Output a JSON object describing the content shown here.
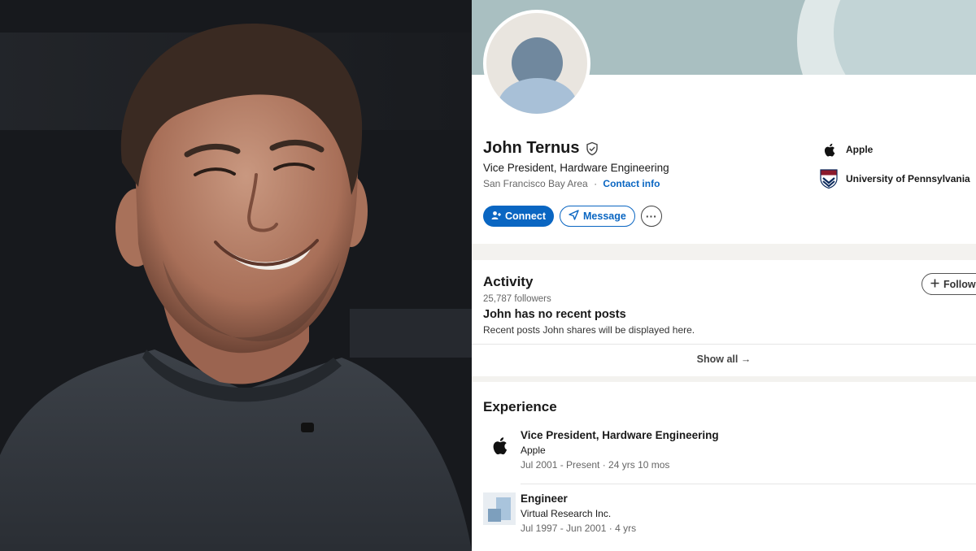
{
  "profile": {
    "name": "John Ternus",
    "headline": "Vice President, Hardware Engineering",
    "location": "San Francisco Bay Area",
    "separator": "·",
    "contact_info": "Contact info",
    "verified_icon": "shield-check-icon"
  },
  "actions": {
    "connect": "Connect",
    "message": "Message",
    "more": "···"
  },
  "orgs": [
    {
      "name": "Apple",
      "icon": "apple-logo-icon"
    },
    {
      "name": "University of Pennsylvania",
      "icon": "penn-shield-icon"
    }
  ],
  "activity": {
    "title": "Activity",
    "followers": "25,787 followers",
    "follow_label": "Follow",
    "empty_title": "John has no recent posts",
    "empty_subtitle": "Recent posts John shares will be displayed here.",
    "show_all": "Show all →"
  },
  "experience": {
    "title": "Experience",
    "items": [
      {
        "title": "Vice President, Hardware Engineering",
        "company": "Apple",
        "dates": "Jul 2001 - Present · 24 yrs 10 mos",
        "logo": "apple-logo-icon"
      },
      {
        "title": "Engineer",
        "company": "Virtual Research Inc.",
        "dates": "Jul 1997 - Jun 2001 · 4 yrs",
        "logo": "company-placeholder-icon"
      }
    ]
  },
  "colors": {
    "brand_blue": "#0a66c2",
    "banner": "#a9bfc1",
    "page_bg": "#f3f2ef"
  }
}
